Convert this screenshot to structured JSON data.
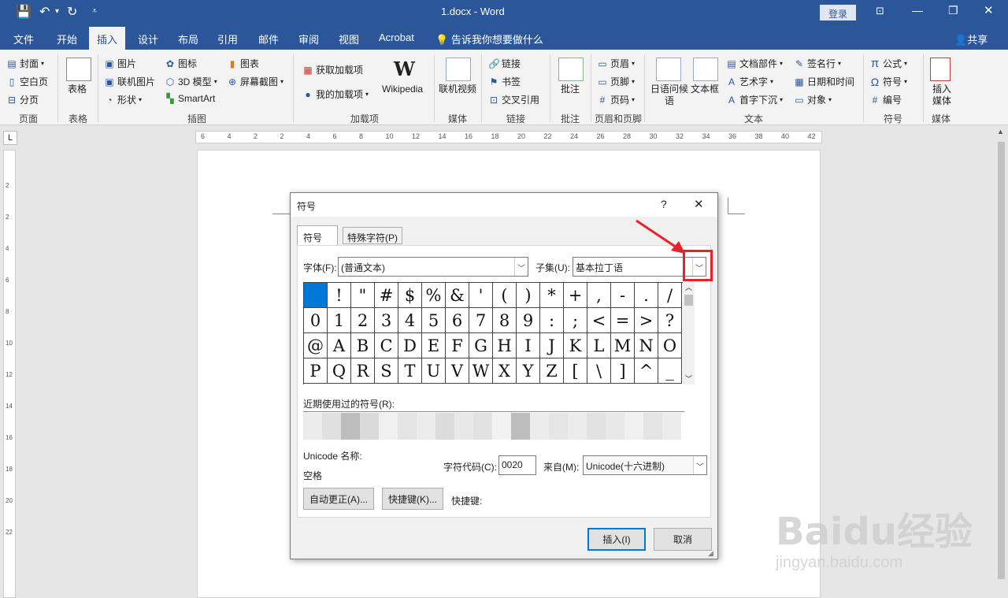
{
  "window": {
    "title": "1.docx  -  Word",
    "login": "登录",
    "share": "共享"
  },
  "tabs": [
    "文件",
    "开始",
    "插入",
    "设计",
    "布局",
    "引用",
    "邮件",
    "审阅",
    "视图",
    "Acrobat"
  ],
  "active_tab": "插入",
  "tell_me": "告诉我你想要做什么",
  "ribbon": {
    "pages": {
      "items": [
        "封面",
        "空白页",
        "分页"
      ],
      "label": "页面"
    },
    "table": {
      "item": "表格",
      "label": "表格"
    },
    "illustrations": {
      "items": [
        "图片",
        "联机图片",
        "形状",
        "图标",
        "3D 模型",
        "SmartArt",
        "图表",
        "屏幕截图"
      ],
      "label": "插图"
    },
    "addins": {
      "items": [
        "获取加载项",
        "我的加载项"
      ],
      "wikipedia": "Wikipedia",
      "label": "加载项"
    },
    "media": {
      "item": "联机视频",
      "label": "媒体"
    },
    "links": {
      "items": [
        "链接",
        "书签",
        "交叉引用"
      ],
      "label": "链接"
    },
    "comments": {
      "item": "批注",
      "label": "批注"
    },
    "header_footer": {
      "items": [
        "页眉",
        "页脚",
        "页码"
      ],
      "label": "页眉和页脚"
    },
    "text": {
      "items": [
        "日语问候语",
        "文本框",
        "文档部件",
        "艺术字",
        "首字下沉",
        "签名行",
        "日期和时间",
        "对象"
      ],
      "label": "文本"
    },
    "symbols": {
      "items": [
        "公式",
        "符号",
        "编号"
      ],
      "label": "符号"
    },
    "media2": {
      "item": "插入媒体",
      "label": "媒体"
    }
  },
  "ruler_h_ticks": [
    "6",
    "4",
    "2",
    "2",
    "4",
    "6",
    "8",
    "10",
    "12",
    "14",
    "16",
    "18",
    "20",
    "22",
    "24",
    "26",
    "28",
    "30",
    "32",
    "34",
    "36",
    "38",
    "40",
    "42"
  ],
  "ruler_v_ticks": [
    "2",
    "2",
    "4",
    "6",
    "8",
    "10",
    "12",
    "14",
    "16",
    "18",
    "20",
    "22"
  ],
  "dialog": {
    "title": "符号",
    "help": "?",
    "close": "✕",
    "tabs": [
      "符号(S)",
      "特殊字符(P)"
    ],
    "font_label": "字体(F):",
    "font_value": "(普通文本)",
    "subset_label": "子集(U):",
    "subset_value": "基本拉丁语",
    "symbols": [
      " ",
      "!",
      "\"",
      "#",
      "$",
      "%",
      "&",
      "'",
      "(",
      ")",
      "*",
      "+",
      ",",
      "-",
      ".",
      "/",
      "0",
      "1",
      "2",
      "3",
      "4",
      "5",
      "6",
      "7",
      "8",
      "9",
      ":",
      ";",
      "<",
      "=",
      ">",
      "?",
      "@",
      "A",
      "B",
      "C",
      "D",
      "E",
      "F",
      "G",
      "H",
      "I",
      "J",
      "K",
      "L",
      "M",
      "N",
      "O",
      "P",
      "Q",
      "R",
      "S",
      "T",
      "U",
      "V",
      "W",
      "X",
      "Y",
      "Z",
      "[",
      "\\",
      "]",
      "^",
      "_"
    ],
    "recent_label": "近期使用过的符号(R):",
    "unicode_name_label": "Unicode 名称:",
    "unicode_name_value": "空格",
    "char_code_label": "字符代码(C):",
    "char_code_value": "0020",
    "from_label": "来自(M):",
    "from_value": "Unicode(十六进制)",
    "autocorrect_button": "自动更正(A)...",
    "shortcut_key_button": "快捷键(K)...",
    "shortcut_label": "快捷键:",
    "insert_button": "插入(I)",
    "cancel_button": "取消"
  },
  "watermark": {
    "brand": "Baidu经验",
    "url": "jingyan.baidu.com"
  },
  "colors": {
    "accent": "#2b579a",
    "selected": "#0078d7",
    "highlight": "#e8222a"
  }
}
